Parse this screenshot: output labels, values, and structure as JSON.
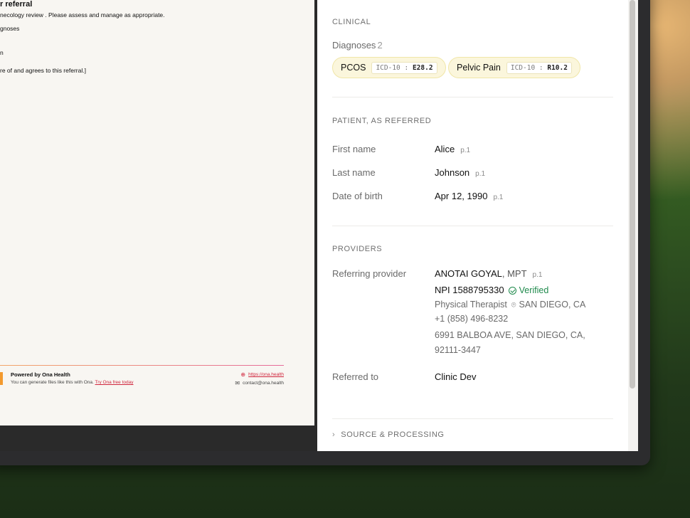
{
  "pdf": {
    "title": "r referral",
    "lines": [
      "necology review . Please assess and manage as appropriate.",
      "gnoses",
      "n",
      "re of and agrees to this referral.]"
    ],
    "footer": {
      "powered_by": "Powered by Ona Health",
      "generate_text": "You can generate files like this with Ona.",
      "try_link": "Try Ona free today",
      "url": "https://ona.health",
      "email": "contact@ona.health"
    }
  },
  "clinical": {
    "heading": "CLINICAL",
    "diagnoses_label": "Diagnoses",
    "diagnoses_count": "2",
    "diagnoses": [
      {
        "name": "PCOS",
        "code_system": "ICD-10",
        "code": "E28.2"
      },
      {
        "name": "Pelvic Pain",
        "code_system": "ICD-10",
        "code": "R10.2"
      }
    ]
  },
  "patient": {
    "heading": "PATIENT, AS REFERRED",
    "fields": [
      {
        "label": "First name",
        "value": "Alice",
        "page": "p.1"
      },
      {
        "label": "Last name",
        "value": "Johnson",
        "page": "p.1"
      },
      {
        "label": "Date of birth",
        "value": "Apr 12, 1990",
        "page": "p.1"
      }
    ]
  },
  "providers": {
    "heading": "PROVIDERS",
    "referring_label": "Referring provider",
    "referring": {
      "name": "ANOTAI GOYAL",
      "credential": ", MPT",
      "page": "p.1",
      "npi": "NPI 1588795330",
      "verified": "Verified",
      "specialty": "Physical Therapist",
      "location": "SAN DIEGO, CA",
      "phone": "+1 (858) 496-8232",
      "address_line1": "6991 BALBOA AVE, SAN DIEGO, CA,",
      "address_line2": "92111-3447"
    },
    "referred_to_label": "Referred to",
    "referred_to": "Clinic Dev"
  },
  "source": {
    "label": "SOURCE & PROCESSING"
  },
  "colors": {
    "chip_bg": "#fbf6dc",
    "verified": "#1f8a4c",
    "link": "#d0263d"
  }
}
